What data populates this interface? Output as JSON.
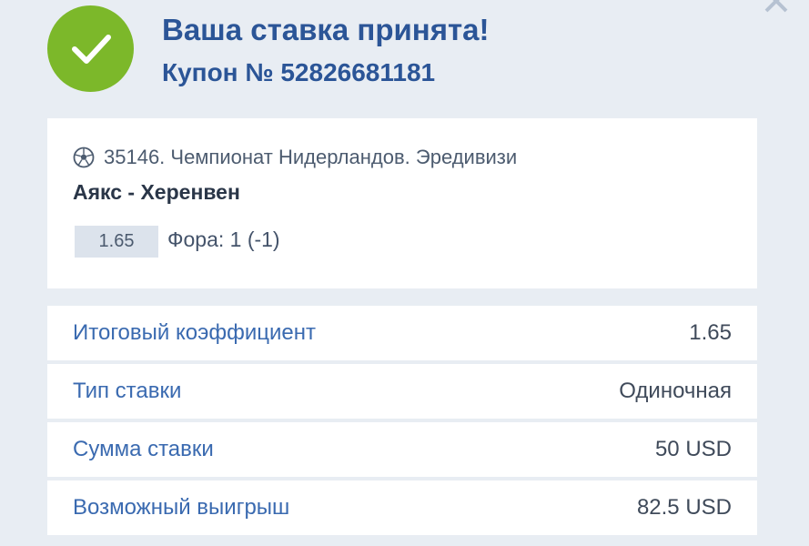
{
  "header": {
    "title": "Ваша ставка принята!",
    "coupon": "Купон № 52826681181"
  },
  "icons": {
    "success": "check-circle-icon",
    "sport": "soccer-ball-icon",
    "close": "close-icon"
  },
  "bet": {
    "event_line": "35146. Чемпионат Нидерландов. Эредивизи",
    "match": "Аякс - Херенвен",
    "odd": "1.65",
    "bet_type": "Фора: 1 (-1)"
  },
  "summary": [
    {
      "label": "Итоговый коэффициент",
      "value": "1.65"
    },
    {
      "label": "Тип ставки",
      "value": "Одиночная"
    },
    {
      "label": "Сумма ставки",
      "value": "50 USD"
    },
    {
      "label": "Возможный выигрыш",
      "value": "82.5 USD"
    }
  ],
  "colors": {
    "background": "#e8edf3",
    "accent": "#2b5597",
    "success": "#7cb82a",
    "label": "#3a6ab0"
  }
}
